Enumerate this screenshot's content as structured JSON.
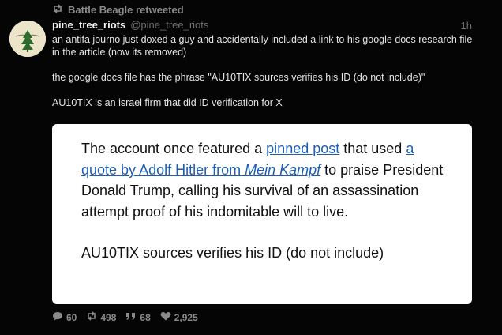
{
  "retweet": {
    "label": "Battle Beagle retweeted"
  },
  "tweet": {
    "author_name": "pine_tree_riots",
    "author_handle": "@pine_tree_riots",
    "time": "1h",
    "paragraphs": [
      "an antifa journo just doxed a guy and accidentally included a link to his google docs research file in the article (now its removed)",
      "the google docs file has the phrase \"AU10TIX sources verifies his ID (do not include)\"",
      "AU10TIX is an israel firm that did ID verification for X"
    ]
  },
  "quote": {
    "seg1": "The account once featured a ",
    "link1": "pinned post",
    "seg2": " that used ",
    "link2a": "a quote by Adolf Hitler from ",
    "link2b": "Mein Kampf",
    "seg3": " to praise President Donald Trump, calling his survival of an assassination attempt proof of his indomitable will to live.",
    "second": "AU10TIX sources verifies his ID (do not include)"
  },
  "actions": {
    "replies": "60",
    "retweets": "498",
    "quotes": "68",
    "likes": "2,925"
  },
  "colors": {
    "background": "#050505",
    "link": "#1a5fb4",
    "muted": "#8a8a8a"
  }
}
